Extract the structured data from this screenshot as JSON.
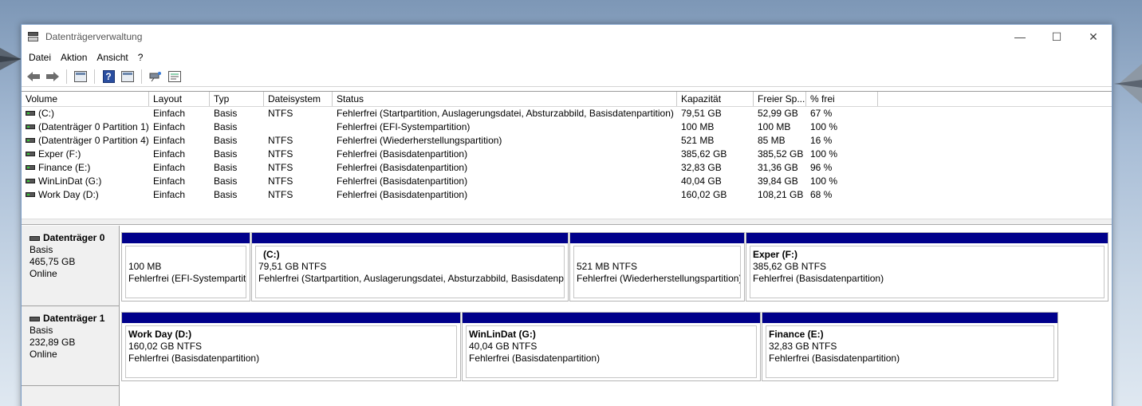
{
  "window": {
    "title": "Datenträgerverwaltung",
    "controls": {
      "minimize": "—",
      "maximize": "☐",
      "close": "✕"
    }
  },
  "menu": [
    "Datei",
    "Aktion",
    "Ansicht",
    "?"
  ],
  "toolbar": {
    "icons": [
      "back-arrow-icon",
      "forward-arrow-icon",
      "properties-icon",
      "help-icon",
      "list-view-icon",
      "connect-icon",
      "settings-icon"
    ],
    "help_glyph": "?"
  },
  "columns": [
    "Volume",
    "Layout",
    "Typ",
    "Dateisystem",
    "Status",
    "Kapazität",
    "Freier Sp...",
    "% frei"
  ],
  "volumes": [
    {
      "volume": "(C:)",
      "layout": "Einfach",
      "typ": "Basis",
      "fs": "NTFS",
      "status": "Fehlerfrei (Startpartition, Auslagerungsdatei, Absturzabbild, Basisdatenpartition)",
      "kap": "79,51 GB",
      "frei": "52,99 GB",
      "pct": "67 %"
    },
    {
      "volume": "(Datenträger 0 Partition 1)",
      "layout": "Einfach",
      "typ": "Basis",
      "fs": "",
      "status": "Fehlerfrei (EFI-Systempartition)",
      "kap": "100 MB",
      "frei": "100 MB",
      "pct": "100 %"
    },
    {
      "volume": "(Datenträger 0 Partition 4)",
      "layout": "Einfach",
      "typ": "Basis",
      "fs": "NTFS",
      "status": "Fehlerfrei (Wiederherstellungspartition)",
      "kap": "521 MB",
      "frei": "85 MB",
      "pct": "16 %"
    },
    {
      "volume": "Exper (F:)",
      "layout": "Einfach",
      "typ": "Basis",
      "fs": "NTFS",
      "status": "Fehlerfrei (Basisdatenpartition)",
      "kap": "385,62 GB",
      "frei": "385,52 GB",
      "pct": "100 %"
    },
    {
      "volume": "Finance (E:)",
      "layout": "Einfach",
      "typ": "Basis",
      "fs": "NTFS",
      "status": "Fehlerfrei (Basisdatenpartition)",
      "kap": "32,83 GB",
      "frei": "31,36 GB",
      "pct": "96 %"
    },
    {
      "volume": "WinLinDat (G:)",
      "layout": "Einfach",
      "typ": "Basis",
      "fs": "NTFS",
      "status": "Fehlerfrei (Basisdatenpartition)",
      "kap": "40,04 GB",
      "frei": "39,84 GB",
      "pct": "100 %"
    },
    {
      "volume": "Work Day (D:)",
      "layout": "Einfach",
      "typ": "Basis",
      "fs": "NTFS",
      "status": "Fehlerfrei (Basisdatenpartition)",
      "kap": "160,02 GB",
      "frei": "108,21 GB",
      "pct": "68 %"
    }
  ],
  "disks": [
    {
      "name": "Datenträger 0",
      "type": "Basis",
      "size": "465,75 GB",
      "state": "Online",
      "partitions": [
        {
          "name": "",
          "size": "100 MB",
          "status": "Fehlerfrei (EFI-Systempartition)"
        },
        {
          "name": "(C:)",
          "size": "79,51 GB NTFS",
          "status": "Fehlerfrei (Startpartition, Auslagerungsdatei, Absturzabbild, Basisdatenpartition)"
        },
        {
          "name": "",
          "size": "521 MB NTFS",
          "status": "Fehlerfrei (Wiederherstellungspartition)"
        },
        {
          "name": "Exper  (F:)",
          "size": "385,62 GB NTFS",
          "status": "Fehlerfrei (Basisdatenpartition)"
        }
      ]
    },
    {
      "name": "Datenträger 1",
      "type": "Basis",
      "size": "232,89 GB",
      "state": "Online",
      "partitions": [
        {
          "name": "Work Day  (D:)",
          "size": "160,02 GB NTFS",
          "status": "Fehlerfrei (Basisdatenpartition)"
        },
        {
          "name": "WinLinDat  (G:)",
          "size": "40,04 GB NTFS",
          "status": "Fehlerfrei (Basisdatenpartition)"
        },
        {
          "name": "Finance  (E:)",
          "size": "32,83 GB NTFS",
          "status": "Fehlerfrei (Basisdatenpartition)"
        }
      ]
    }
  ],
  "colors": {
    "partition_bar": "#00008b",
    "label_bg": "#f0f0f0"
  }
}
